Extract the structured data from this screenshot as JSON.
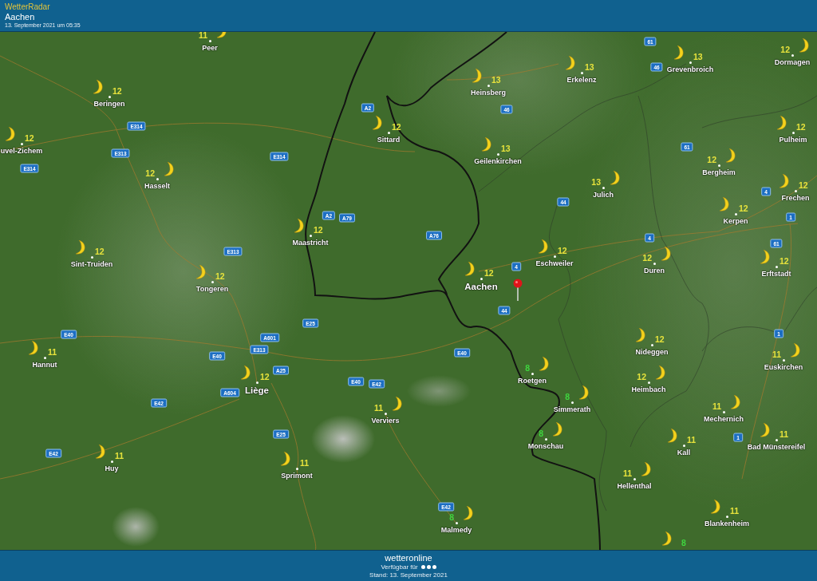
{
  "app": {
    "title": "WetterRadar",
    "location": "Aachen",
    "timestamp": "13. September 2021 um 05:35"
  },
  "map": {
    "cities": [
      {
        "name": "Peer",
        "temperature": "11",
        "color": "#e6e23c"
      },
      {
        "name": "Beringen",
        "temperature": "12",
        "color": "#e6e23c"
      },
      {
        "name": "uvel-Zichem",
        "temperature": "12",
        "color": "#e6e23c"
      },
      {
        "name": "Hasselt",
        "temperature": "12",
        "color": "#e6e23c"
      },
      {
        "name": "Sint-Truiden",
        "temperature": "12",
        "color": "#e6e23c"
      },
      {
        "name": "Tongeren",
        "temperature": "12",
        "color": "#e6e23c"
      },
      {
        "name": "Sittard",
        "temperature": "12",
        "color": "#e6e23c"
      },
      {
        "name": "Maastricht",
        "temperature": "12",
        "color": "#e6e23c"
      },
      {
        "name": "Heinsberg",
        "temperature": "13",
        "color": "#e6e23c"
      },
      {
        "name": "Erkelenz",
        "temperature": "13",
        "color": "#e6e23c"
      },
      {
        "name": "Grevenbroich",
        "temperature": "13",
        "color": "#e6e23c"
      },
      {
        "name": "Dormagen",
        "temperature": "12",
        "color": "#e6e23c"
      },
      {
        "name": "Geilenkirchen",
        "temperature": "13",
        "color": "#e6e23c"
      },
      {
        "name": "Pulheim",
        "temperature": "12",
        "color": "#e6e23c"
      },
      {
        "name": "Bergheim",
        "temperature": "12",
        "color": "#e6e23c"
      },
      {
        "name": "Julich",
        "temperature": "13",
        "color": "#e6e23c"
      },
      {
        "name": "Frechen",
        "temperature": "12",
        "color": "#e6e23c"
      },
      {
        "name": "Kerpen",
        "temperature": "12",
        "color": "#e6e23c"
      },
      {
        "name": "Eschweiler",
        "temperature": "12",
        "color": "#e6e23c"
      },
      {
        "name": "Duren",
        "temperature": "12",
        "color": "#e6e23c"
      },
      {
        "name": "Erftstadt",
        "temperature": "12",
        "color": "#e6e23c"
      },
      {
        "name": "Aachen",
        "temperature": "12",
        "color": "#e6e23c"
      },
      {
        "name": "Hannut",
        "temperature": "11",
        "color": "#e6e23c"
      },
      {
        "name": "Liège",
        "temperature": "12",
        "color": "#e6e23c"
      },
      {
        "name": "Verviers",
        "temperature": "11",
        "color": "#e6e23c"
      },
      {
        "name": "Huy",
        "temperature": "11",
        "color": "#e6e23c"
      },
      {
        "name": "Sprimont",
        "temperature": "11",
        "color": "#e6e23c"
      },
      {
        "name": "Roetgen",
        "temperature": "8",
        "color": "#3fd43f"
      },
      {
        "name": "Simmerath",
        "temperature": "8",
        "color": "#3fd43f"
      },
      {
        "name": "Monschau",
        "temperature": "8",
        "color": "#3fd43f"
      },
      {
        "name": "Nideggen",
        "temperature": "12",
        "color": "#e6e23c"
      },
      {
        "name": "Heimbach",
        "temperature": "12",
        "color": "#e6e23c"
      },
      {
        "name": "Euskirchen",
        "temperature": "11",
        "color": "#e6e23c"
      },
      {
        "name": "Mechernich",
        "temperature": "11",
        "color": "#e6e23c"
      },
      {
        "name": "Bad Münstereifel",
        "temperature": "11",
        "color": "#e6e23c"
      },
      {
        "name": "Kall",
        "temperature": "11",
        "color": "#e6e23c"
      },
      {
        "name": "Hellenthal",
        "temperature": "11",
        "color": "#e6e23c"
      },
      {
        "name": "Malmedy",
        "temperature": "8",
        "color": "#3fd43f"
      },
      {
        "name": "Blankenheim",
        "temperature": "11",
        "color": "#e6e23c"
      },
      {
        "temperature": "8",
        "color": "#3fd43f"
      }
    ],
    "road_signs": [
      "61",
      "46",
      "A2",
      "46",
      "E314",
      "E313",
      "E314",
      "E314",
      "61",
      "4",
      "44",
      "1",
      "A2",
      "A79",
      "A76",
      "E313",
      "4",
      "61",
      "4",
      "44",
      "E40",
      "E25",
      "A601",
      "E313",
      "E40",
      "A25",
      "E40",
      "E40",
      "E42",
      "A604",
      "E42",
      "E25",
      "1",
      "1",
      "E42",
      "E42"
    ]
  },
  "footer": {
    "logo": "wetteronline",
    "availability": "Verfügbar für",
    "updated": "Stand: 13. September 2021"
  }
}
